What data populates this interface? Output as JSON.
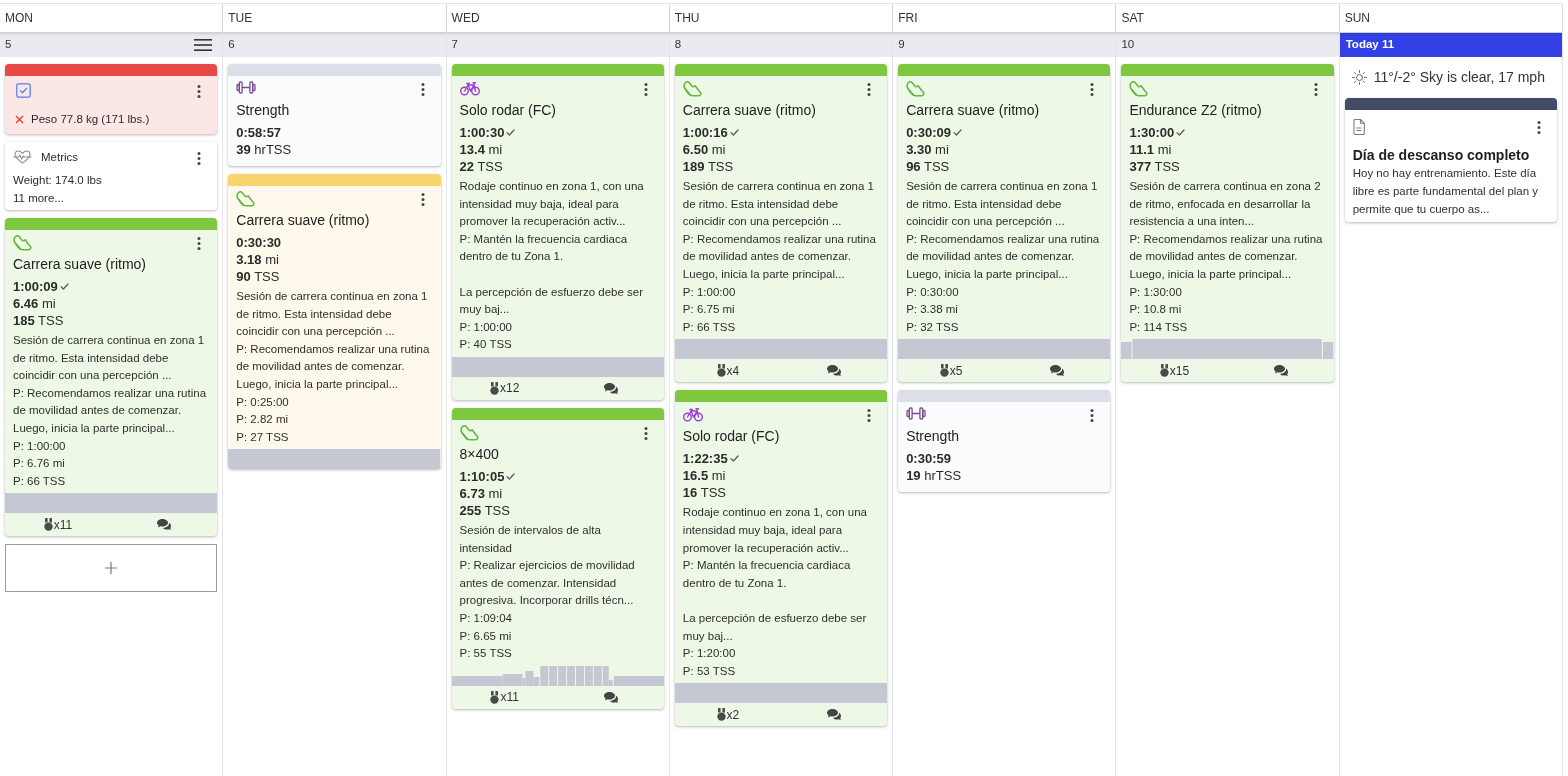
{
  "days": [
    {
      "name": "MON",
      "date": "5",
      "today": false,
      "menu": true,
      "add_button": true,
      "cards": [
        {
          "kind": "metric_entry",
          "color": "#e94848",
          "entries": [
            {
              "text": "Peso 77.8 kg (171 lbs.)",
              "met": false
            }
          ]
        },
        {
          "kind": "metrics",
          "title": "Metrics",
          "lines": [
            "Weight: 174.0 lbs"
          ],
          "more": "11 more..."
        },
        {
          "kind": "run",
          "color": "#7ec83f",
          "title": "Carrera suave (ritmo)",
          "duration": "1:00:09",
          "completed": true,
          "distance": {
            "value": "6.46",
            "unit": "mi"
          },
          "load": {
            "value": "185",
            "unit": "TSS"
          },
          "description": "Sesión de carrera continua en zona 1 de ritmo. Esta intensidad debe coincidir con una percepción ...",
          "planned_description": "P: Recomendamos realizar una rutina de movilidad antes de comenzar. Luego, inicia la parte principal...",
          "planned": [
            "P: 1:00:00",
            "P: 6.76 mi",
            "P: 66 TSS"
          ],
          "profile": {
            "kind": "flat"
          },
          "footer": {
            "records": "x11",
            "comments": true
          }
        }
      ]
    },
    {
      "name": "TUE",
      "date": "6",
      "today": false,
      "cards": [
        {
          "kind": "strength",
          "color": "#dcdfe7",
          "title": "Strength",
          "duration": "0:58:57",
          "completed": false,
          "load": {
            "value": "39",
            "unit": "hrTSS"
          }
        },
        {
          "kind": "run",
          "color": "#f8d46c",
          "title": "Carrera suave (ritmo)",
          "duration": "0:30:30",
          "completed": false,
          "distance": {
            "value": "3.18",
            "unit": "mi"
          },
          "load": {
            "value": "90",
            "unit": "TSS"
          },
          "description": "Sesión de carrera continua en zona 1 de ritmo. Esta intensidad debe coincidir con una percepción ...",
          "planned_description": "P: Recomendamos realizar una rutina de movilidad antes de comenzar. Luego, inicia la parte principal...",
          "planned": [
            "P: 0:25:00",
            "P: 2.82 mi",
            "P: 27 TSS"
          ],
          "profile": {
            "kind": "flat"
          }
        }
      ]
    },
    {
      "name": "WED",
      "date": "7",
      "today": false,
      "cards": [
        {
          "kind": "bike",
          "color": "#7ec83f",
          "title": "Solo rodar (FC)",
          "duration": "1:00:30",
          "completed": true,
          "distance": {
            "value": "13.4",
            "unit": "mi"
          },
          "load": {
            "value": "22",
            "unit": "TSS"
          },
          "description": "Rodaje continuo en zona 1, con una intensidad muy baja, ideal para promover la recuperación activ...",
          "planned_description": "P: Mantén la frecuencia cardiaca dentro de tu Zona 1.\n\nLa percepción de esfuerzo debe ser muy baj...",
          "planned": [
            "P: 1:00:00",
            "P: 40 TSS"
          ],
          "profile": {
            "kind": "flat"
          },
          "footer": {
            "records": "x12",
            "comments": true
          }
        },
        {
          "kind": "run",
          "color": "#7ec83f",
          "title": "8×400",
          "duration": "1:10:05",
          "completed": true,
          "distance": {
            "value": "6.73",
            "unit": "mi"
          },
          "load": {
            "value": "255",
            "unit": "TSS"
          },
          "description": "Sesión de intervalos de alta intensidad",
          "planned_description": "P: Realizar ejercicios de movilidad antes de comenzar. Intensidad progresiva. Incorporar drills técn...",
          "planned": [
            "P: 1:09:04",
            "P: 6.65 mi",
            "P: 55 TSS"
          ],
          "profile": {
            "kind": "intervals"
          },
          "footer": {
            "records": "x11",
            "comments": true
          }
        }
      ]
    },
    {
      "name": "THU",
      "date": "8",
      "today": false,
      "cards": [
        {
          "kind": "run",
          "color": "#7ec83f",
          "title": "Carrera suave (ritmo)",
          "duration": "1:00:16",
          "completed": true,
          "distance": {
            "value": "6.50",
            "unit": "mi"
          },
          "load": {
            "value": "189",
            "unit": "TSS"
          },
          "description": "Sesión de carrera continua en zona 1 de ritmo. Esta intensidad debe coincidir con una percepción ...",
          "planned_description": "P: Recomendamos realizar una rutina de movilidad antes de comenzar. Luego, inicia la parte principal...",
          "planned": [
            "P: 1:00:00",
            "P: 6.75 mi",
            "P: 66 TSS"
          ],
          "profile": {
            "kind": "flat"
          },
          "footer": {
            "records": "x4",
            "comments": true
          }
        },
        {
          "kind": "bike",
          "color": "#7ec83f",
          "title": "Solo rodar (FC)",
          "duration": "1:22:35",
          "completed": true,
          "distance": {
            "value": "16.5",
            "unit": "mi"
          },
          "load": {
            "value": "16",
            "unit": "TSS"
          },
          "description": "Rodaje continuo en zona 1, con una intensidad muy baja, ideal para promover la recuperación activ...",
          "planned_description": "P: Mantén la frecuencia cardiaca dentro de tu Zona 1.\n\nLa percepción de esfuerzo debe ser muy baj...",
          "planned": [
            "P: 1:20:00",
            "P: 53 TSS"
          ],
          "profile": {
            "kind": "flat"
          },
          "footer": {
            "records": "x2",
            "comments": true
          }
        }
      ]
    },
    {
      "name": "FRI",
      "date": "9",
      "today": false,
      "cards": [
        {
          "kind": "run",
          "color": "#7ec83f",
          "title": "Carrera suave (ritmo)",
          "duration": "0:30:09",
          "completed": true,
          "distance": {
            "value": "3.30",
            "unit": "mi"
          },
          "load": {
            "value": "96",
            "unit": "TSS"
          },
          "description": "Sesión de carrera continua en zona 1 de ritmo. Esta intensidad debe coincidir con una percepción ...",
          "planned_description": "P: Recomendamos realizar una rutina de movilidad antes de comenzar. Luego, inicia la parte principal...",
          "planned": [
            "P: 0:30:00",
            "P: 3.38 mi",
            "P: 32 TSS"
          ],
          "profile": {
            "kind": "flat"
          },
          "footer": {
            "records": "x5",
            "comments": true
          }
        },
        {
          "kind": "strength",
          "color": "#dcdfe7",
          "title": "Strength",
          "duration": "0:30:59",
          "completed": false,
          "load": {
            "value": "19",
            "unit": "hrTSS"
          }
        }
      ]
    },
    {
      "name": "SAT",
      "date": "10",
      "today": false,
      "cards": [
        {
          "kind": "run",
          "color": "#7ec83f",
          "title": "Endurance Z2 (ritmo)",
          "duration": "1:30:00",
          "completed": true,
          "distance": {
            "value": "11.1",
            "unit": "mi"
          },
          "load": {
            "value": "377",
            "unit": "TSS"
          },
          "description": "Sesión de carrera continua en zona 2 de ritmo, enfocada en desarrollar la resistencia a una inten...",
          "planned_description": "P: Recomendamos realizar una rutina de movilidad antes de comenzar. Luego, inicia la parte principal...",
          "planned": [
            "P: 1:30:00",
            "P: 10.8 mi",
            "P: 114 TSS"
          ],
          "profile": {
            "kind": "segments"
          },
          "footer": {
            "records": "x15",
            "comments": true
          }
        }
      ]
    },
    {
      "name": "SUN",
      "date": "Today 11",
      "today": true,
      "weather": {
        "text": "11°/-2° Sky is clear, 17 mph"
      },
      "cards": [
        {
          "kind": "note",
          "title": "Día de descanso completo",
          "description": "Hoy no hay entrenamiento. Este día libre es parte fundamental del plan y permite que tu cuerpo as..."
        }
      ]
    }
  ]
}
